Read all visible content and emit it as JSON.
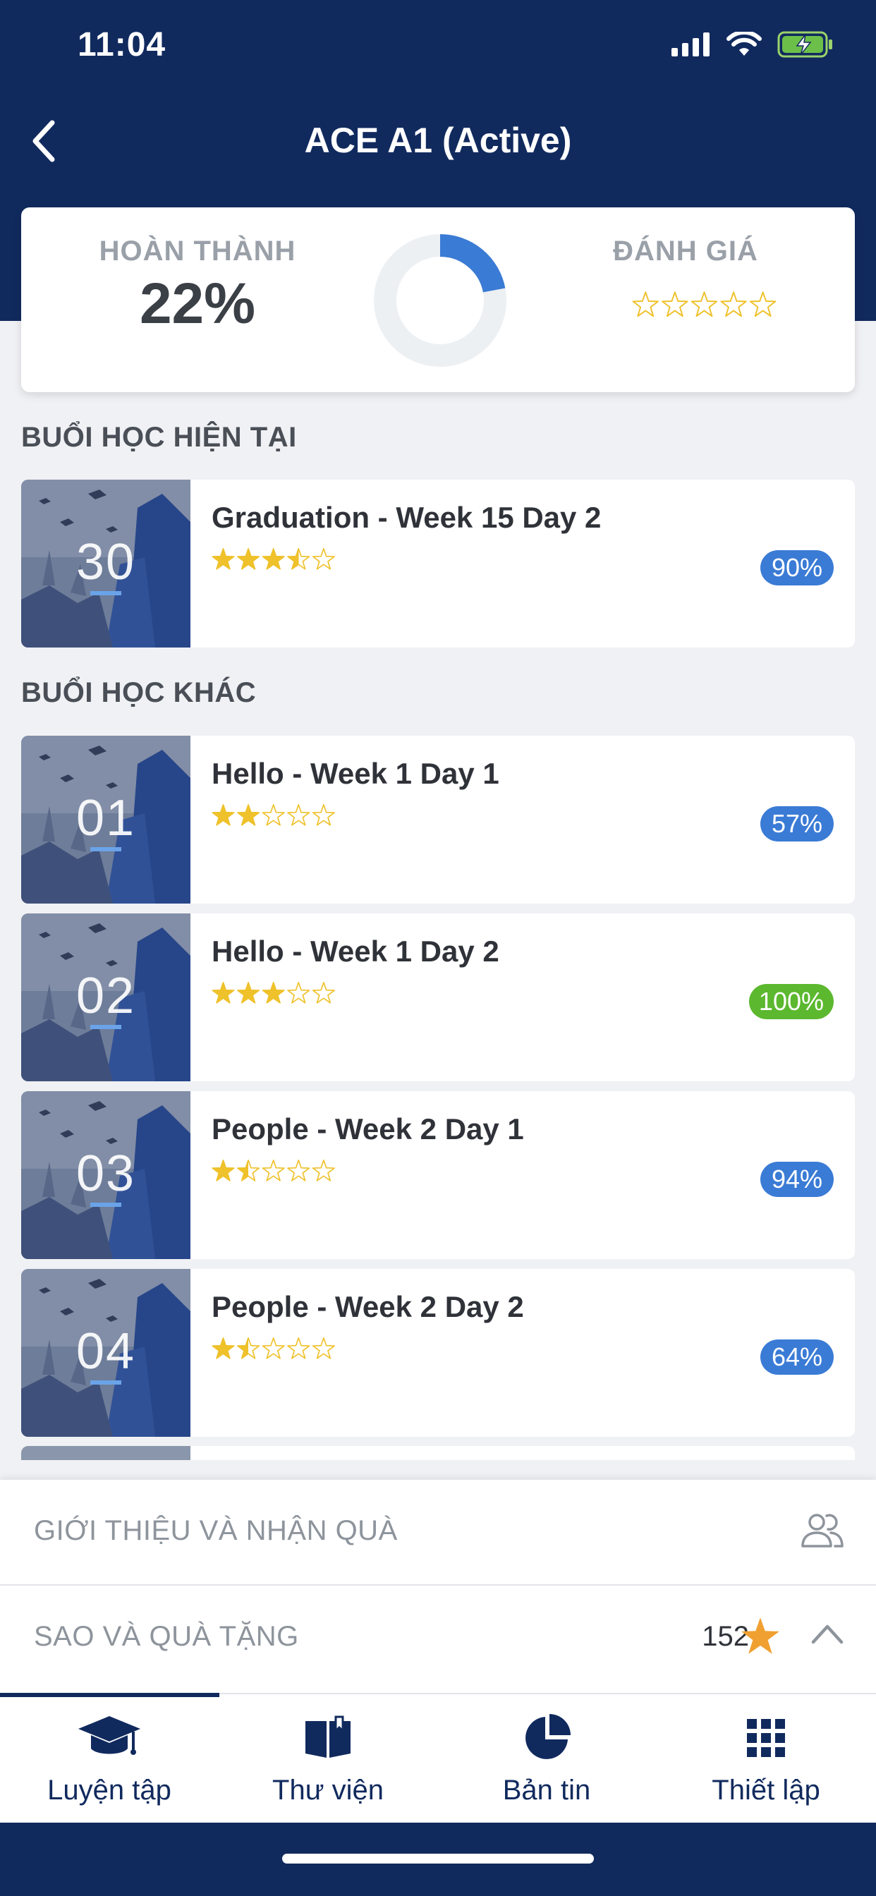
{
  "status_bar": {
    "time": "11:04"
  },
  "nav": {
    "title": "ACE A1 (Active)"
  },
  "summary": {
    "complete_label": "HOÀN THÀNH",
    "complete_value": "22%",
    "complete_fraction": 0.22,
    "rating_label": "ĐÁNH GIÁ",
    "rating_stars": 0
  },
  "current_section": {
    "title": "BUỔI HỌC HIỆN TẠI",
    "lesson": {
      "number": "30",
      "title": "Graduation - Week 15 Day 2",
      "stars": 3.5,
      "percent": "90%"
    }
  },
  "other_section": {
    "title": "BUỔI HỌC KHÁC",
    "lessons": [
      {
        "number": "01",
        "title": "Hello - Week 1 Day 1",
        "stars": 2,
        "percent": "57%"
      },
      {
        "number": "02",
        "title": "Hello - Week 1 Day 2",
        "stars": 3,
        "percent": "100%"
      },
      {
        "number": "03",
        "title": "People - Week 2 Day 1",
        "stars": 1.5,
        "percent": "94%"
      },
      {
        "number": "04",
        "title": "People - Week 2 Day 2",
        "stars": 1.5,
        "percent": "64%"
      }
    ]
  },
  "info_panel": {
    "referral_label": "GIỚI THIỆU VÀ NHẬN QUÀ",
    "stars_label": "SAO VÀ QUÀ TẶNG",
    "star_count": "152"
  },
  "tabs": [
    {
      "label": "Luyện tập",
      "icon": "graduation-cap-icon"
    },
    {
      "label": "Thư viện",
      "icon": "book-icon"
    },
    {
      "label": "Bản tin",
      "icon": "pie-chart-icon"
    },
    {
      "label": "Thiết lập",
      "icon": "grid-icon"
    }
  ],
  "colors": {
    "brand": "#112a5e",
    "accent_blue": "#3a7bd5",
    "success_green": "#5cb82e",
    "star_gold": "#efc12a",
    "star_orange": "#f0a030"
  }
}
